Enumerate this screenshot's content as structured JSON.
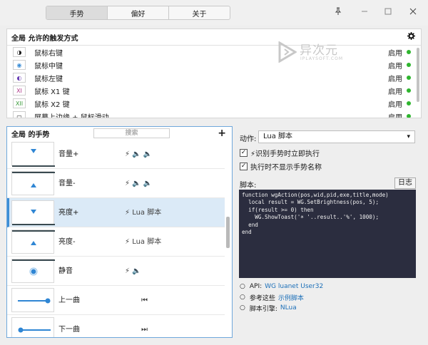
{
  "tabs": [
    {
      "label": "手势",
      "active": true
    },
    {
      "label": "偏好",
      "active": false
    },
    {
      "label": "关于",
      "active": false
    }
  ],
  "window_controls": {
    "pin": "pin-icon",
    "minimize": "minimize-icon",
    "maximize": "maximize-icon",
    "close": "close-icon"
  },
  "triggers": {
    "title": "全局 允许的触发方式",
    "settings_icon": "gear-icon",
    "items": [
      {
        "icon": "◑",
        "label": "鼠标右键",
        "status": "启用"
      },
      {
        "icon": "◉",
        "label": "鼠标中键",
        "status": "启用"
      },
      {
        "icon": "◐",
        "label": "鼠标左键",
        "status": "启用"
      },
      {
        "icon": "XI",
        "label": "鼠标 X1 键",
        "status": "启用"
      },
      {
        "icon": "XII",
        "label": "鼠标 X2 键",
        "status": "启用"
      },
      {
        "icon": "▭",
        "label": "屏幕上边缘 + 鼠标滑动",
        "status": "启用"
      }
    ]
  },
  "watermark": {
    "title": "异次元",
    "subtitle": "IPLAYSOFT.COM"
  },
  "gestures": {
    "title": "全局 的手势",
    "search_placeholder": "搜索",
    "add_label": "+",
    "items": [
      {
        "name": "音量+",
        "actions": "⚡ 🔈 🔈",
        "thumb": "down-arrow",
        "selected": false
      },
      {
        "name": "音量-",
        "actions": "⚡ 🔈 🔈",
        "thumb": "up-arrow",
        "selected": false
      },
      {
        "name": "亮度+",
        "actions": "⚡ Lua 脚本",
        "thumb": "down-arrow",
        "selected": true
      },
      {
        "name": "亮度-",
        "actions": "⚡ Lua 脚本",
        "thumb": "up-arrow",
        "selected": false
      },
      {
        "name": "静音",
        "actions": "⚡ 🔈",
        "thumb": "dot",
        "selected": false
      },
      {
        "name": "上一曲",
        "actions": "⏮",
        "thumb": "line-right-dot",
        "selected": false
      },
      {
        "name": "下一曲",
        "actions": "⏭",
        "thumb": "line-left-dot",
        "selected": false
      }
    ]
  },
  "action": {
    "label": "动作:",
    "selected": "Lua 脚本",
    "checks": [
      {
        "label": "⚡识别手势时立即执行",
        "checked": true
      },
      {
        "label": "执行时不显示手势名称",
        "checked": true
      }
    ],
    "script_label": "脚本:",
    "log_button": "日志",
    "code": "function wgAction(pos,wid,pid,exe,title,mode)\n  local result = WG.SetBrightness(pos, 5);\n  if(result >= 0) then\n    WG.ShowToast('☀ '..result..'%', 1000);\n  end\nend",
    "links": [
      {
        "prefix": "API:",
        "link": "WG luanet User32"
      },
      {
        "prefix": "参考这些",
        "link": "示例脚本"
      },
      {
        "prefix": "脚本引擎:",
        "link": "NLua"
      }
    ]
  },
  "colors": {
    "accent": "#3d8ed6",
    "enabled_dot": "#2fb52f",
    "code_bg": "#2b2d3f",
    "link": "#1c6fb8"
  }
}
